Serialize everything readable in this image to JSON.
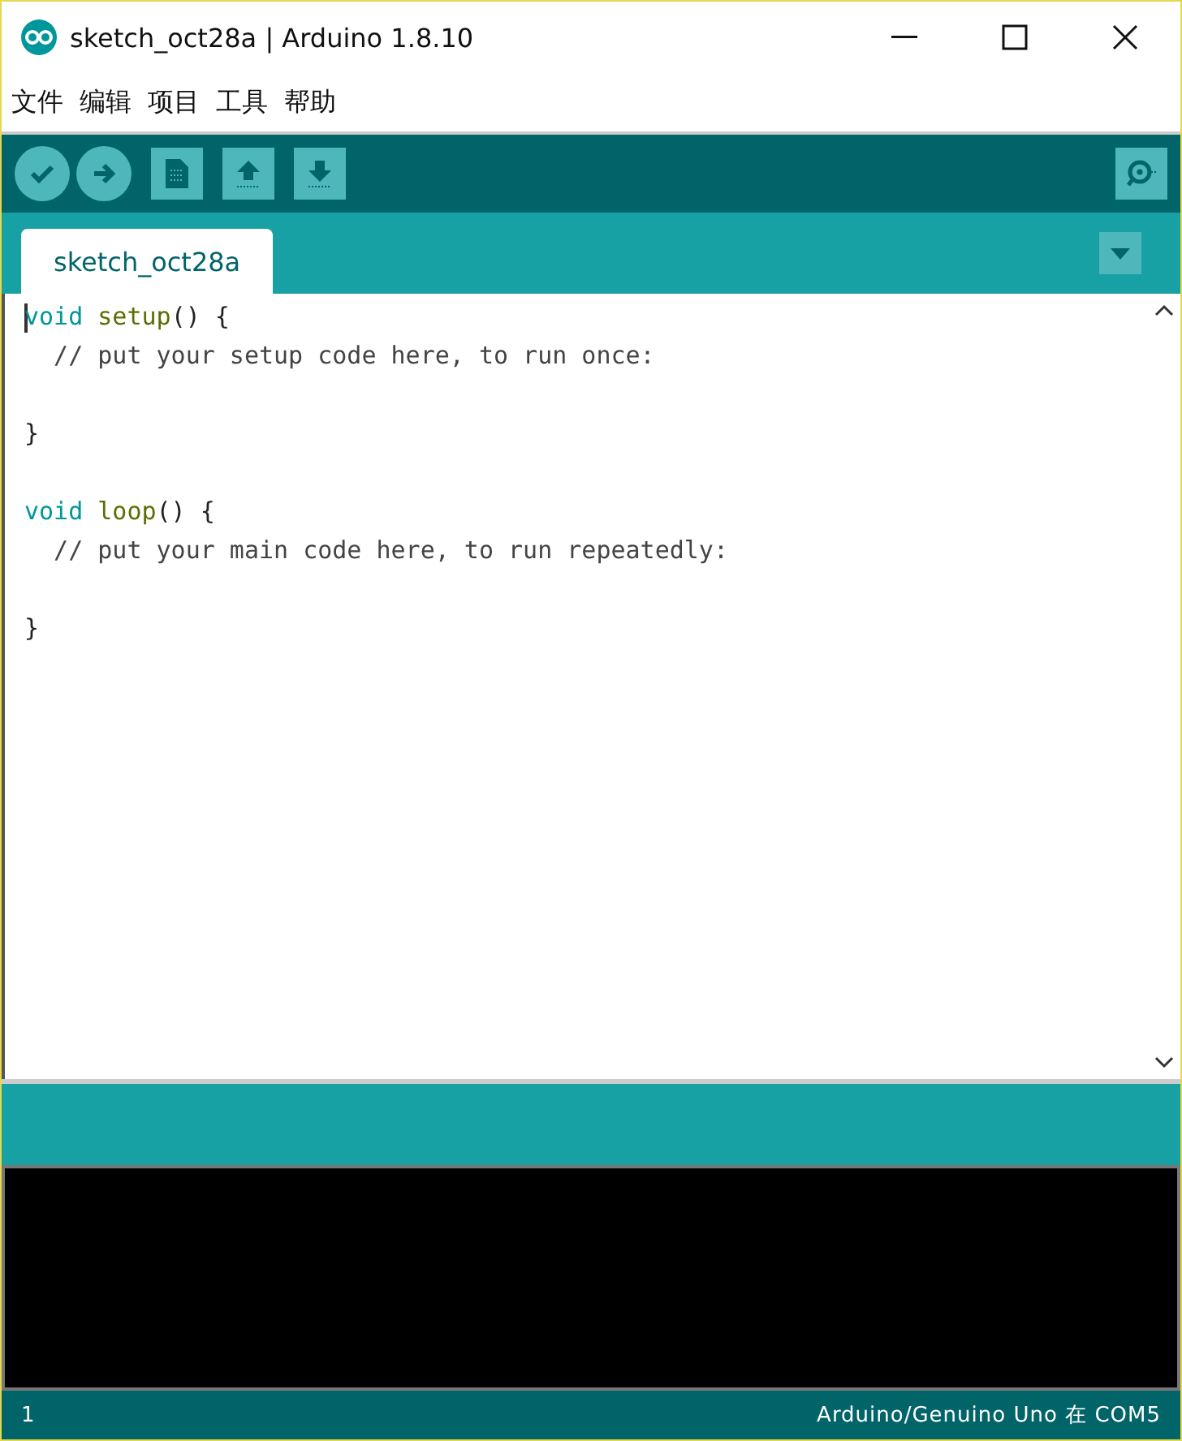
{
  "window": {
    "title": "sketch_oct28a | Arduino 1.8.10"
  },
  "menu": [
    "文件",
    "编辑",
    "项目",
    "工具",
    "帮助"
  ],
  "toolbar": [
    {
      "kind": "verify"
    },
    {
      "kind": "upload"
    },
    {
      "kind": "new"
    },
    {
      "kind": "open"
    },
    {
      "kind": "save"
    }
  ],
  "tabs": [
    {
      "label": "sketch_oct28a",
      "selected": true
    }
  ],
  "editor": {
    "lines": [
      {
        "kind": "code",
        "tokens": [
          {
            "kind": "keyword",
            "text": "void"
          },
          {
            "kind": "function",
            "text": " setup"
          },
          {
            "kind": "plain",
            "text": "() {"
          }
        ]
      },
      {
        "kind": "code",
        "tokens": [
          {
            "kind": "comment",
            "text": "  // put your setup code here, to run once:"
          }
        ]
      },
      {
        "kind": "blank"
      },
      {
        "kind": "code",
        "tokens": [
          {
            "kind": "plain",
            "text": "}"
          }
        ]
      },
      {
        "kind": "blank"
      },
      {
        "kind": "code",
        "tokens": [
          {
            "kind": "keyword",
            "text": "void"
          },
          {
            "kind": "function",
            "text": " loop"
          },
          {
            "kind": "plain",
            "text": "() {"
          }
        ]
      },
      {
        "kind": "code",
        "tokens": [
          {
            "kind": "comment",
            "text": "  // put your main code here, to run repeatedly:"
          }
        ]
      },
      {
        "kind": "blank"
      },
      {
        "kind": "code",
        "tokens": [
          {
            "kind": "plain",
            "text": "}"
          }
        ]
      }
    ]
  },
  "status_bar": {
    "line": "1",
    "board": "Arduino/Genuino Uno 在 COM5"
  }
}
